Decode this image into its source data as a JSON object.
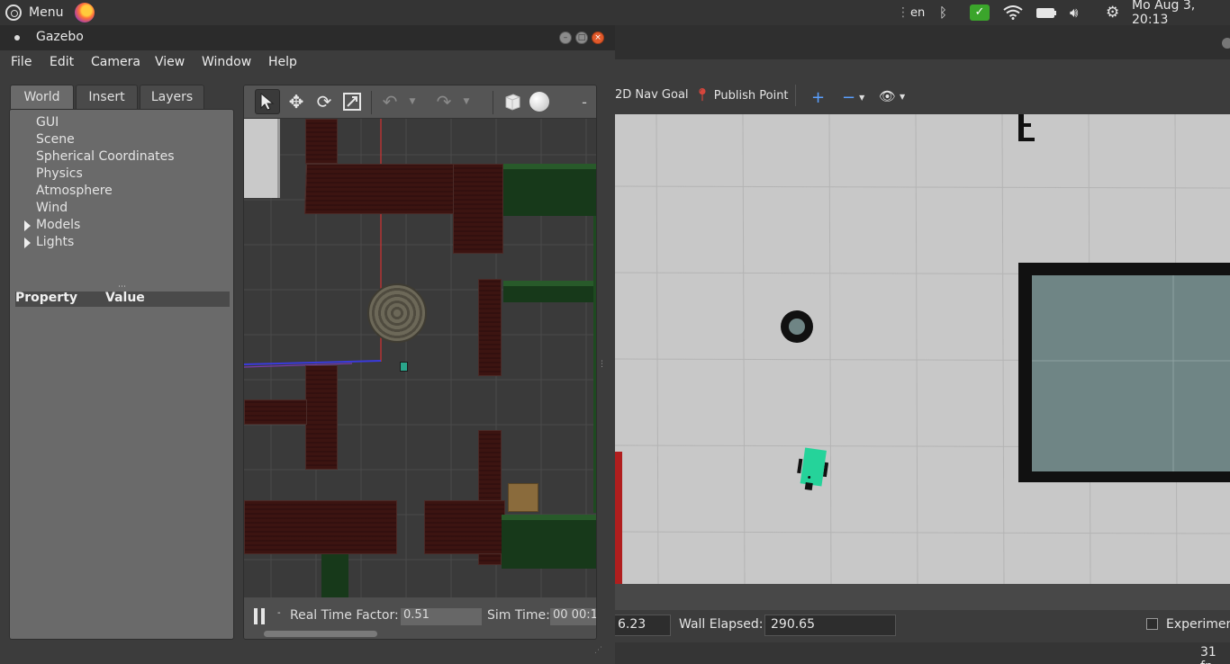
{
  "top_panel": {
    "menu_label": "Menu",
    "language": "en",
    "clock": "Mo Aug  3, 20:13"
  },
  "gazebo": {
    "title": "Gazebo",
    "menu": [
      "File",
      "Edit",
      "Camera",
      "View",
      "Window",
      "Help"
    ],
    "tabs": [
      "World",
      "Insert",
      "Layers"
    ],
    "tree": [
      "GUI",
      "Scene",
      "Spherical Coordinates",
      "Physics",
      "Atmosphere",
      "Wind",
      "Models",
      "Lights"
    ],
    "property_header": {
      "property": "Property",
      "value": "Value"
    },
    "sim_bar": {
      "rtf_label": "Real Time Factor:",
      "rtf_value": "0.51",
      "sim_time_label": "Sim Time:",
      "sim_time_value": "00 00:1"
    }
  },
  "rviz": {
    "toolbar": {
      "nav_goal": "2D Nav Goal",
      "publish_point": "Publish Point"
    },
    "status": {
      "ros_elapsed_value": "6.23",
      "wall_elapsed_label": "Wall Elapsed:",
      "wall_elapsed_value": "290.65",
      "experimental_label": "Experimen"
    },
    "fps": "31 fp"
  },
  "colors": {
    "robot_rviz": "#25d39a",
    "map_occupied": "#111111",
    "map_free": "#c8c8c8",
    "map_costmap": "#6f8585"
  }
}
